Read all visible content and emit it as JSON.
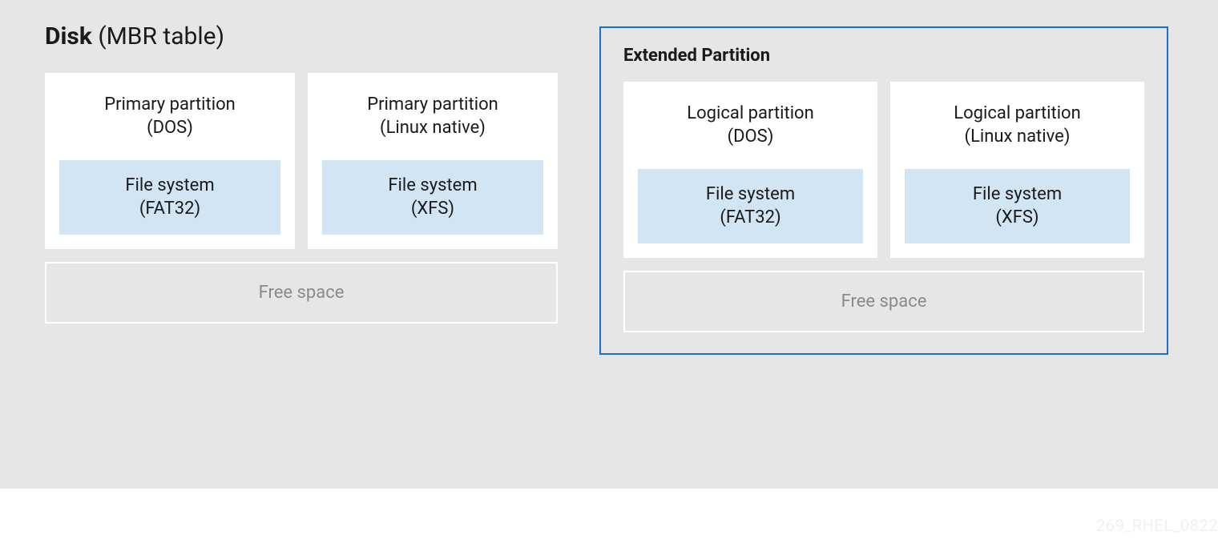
{
  "title": {
    "bold": "Disk",
    "rest": " (MBR table)"
  },
  "primary": {
    "partitions": [
      {
        "name": "Primary partition",
        "type": "(DOS)",
        "fs_name": "File system",
        "fs_type": "(FAT32)"
      },
      {
        "name": "Primary partition",
        "type": "(Linux native)",
        "fs_name": "File system",
        "fs_type": "(XFS)"
      }
    ],
    "free_space": "Free space"
  },
  "extended": {
    "title": "Extended Partition",
    "partitions": [
      {
        "name": "Logical partition",
        "type": "(DOS)",
        "fs_name": "File system",
        "fs_type": "(FAT32)"
      },
      {
        "name": "Logical partition",
        "type": "(Linux native)",
        "fs_name": "File system",
        "fs_type": "(XFS)"
      }
    ],
    "free_space": "Free space"
  },
  "watermark": "269_RHEL_0822"
}
